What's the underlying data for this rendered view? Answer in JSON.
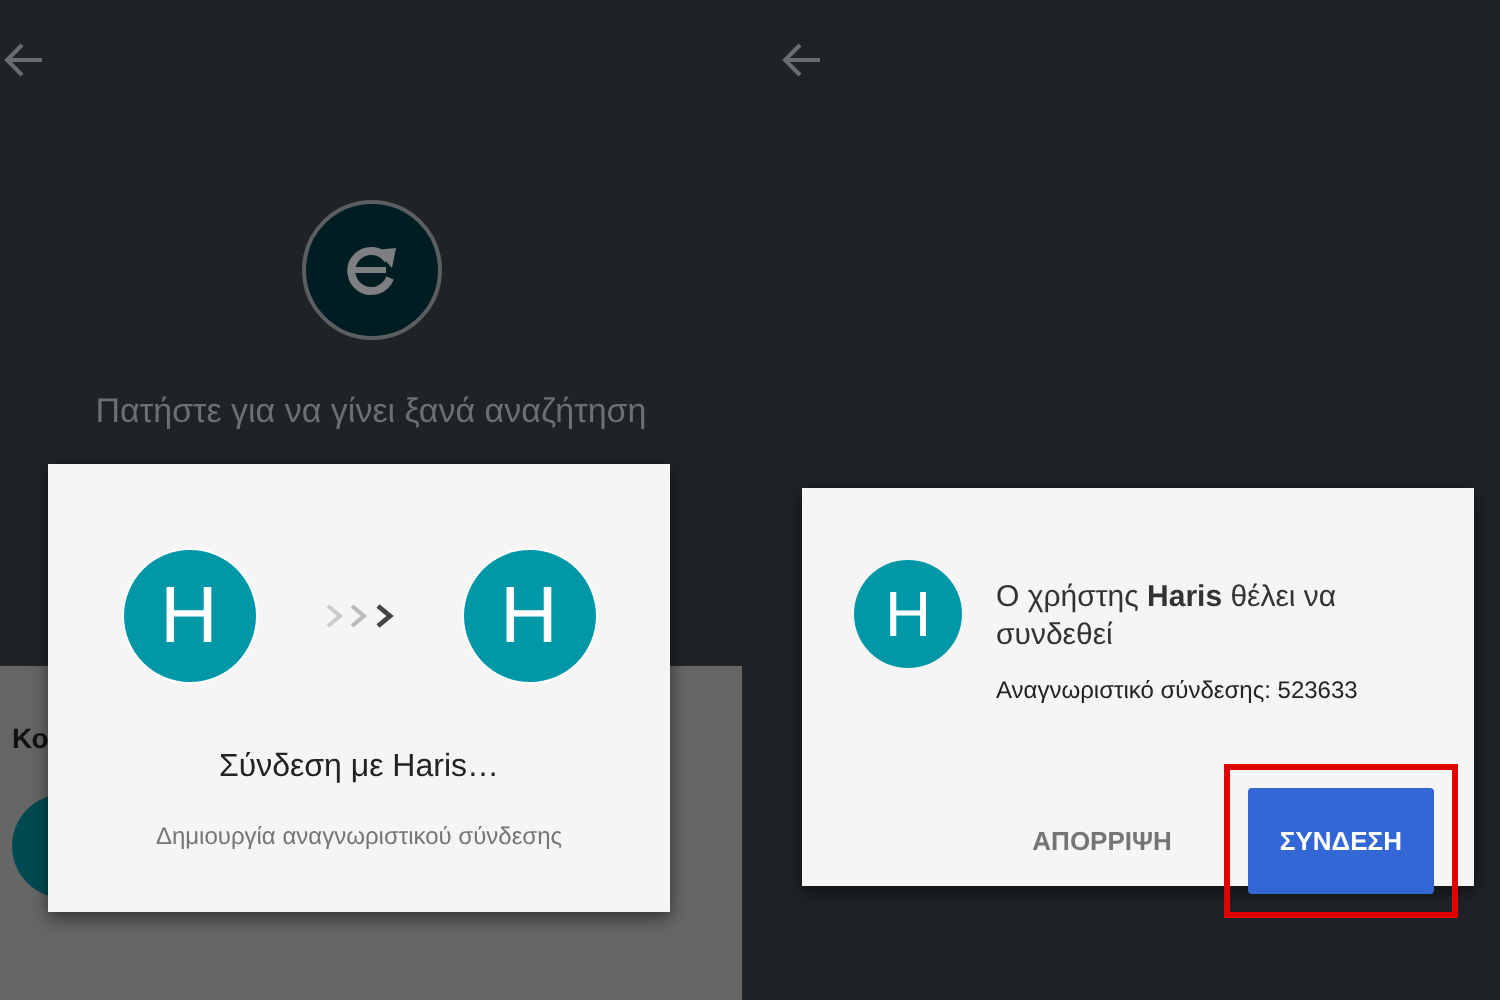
{
  "left_screen": {
    "search_hint": "Πατήστε για να γίνει ξανά αναζήτηση",
    "sheet": {
      "title": "Κο"
    },
    "dialog": {
      "avatars": [
        "H",
        "H"
      ],
      "title": "Σύνδεση με Haris…",
      "subtitle": "Δημιουργία αναγνωριστικού σύνδεσης"
    }
  },
  "right_screen": {
    "dialog": {
      "avatar": "H",
      "message": "Ο χρήστης **Haris** θέλει να συνδεθεί",
      "code": "Αναγνωριστικό σύνδεσης: 523633",
      "buttons": [
        {
          "label": "ΑΠΟΡΡΙΨΗ",
          "kind": "text",
          "highlighted": false
        },
        {
          "label": "ΣΥΝΔΕΣΗ",
          "kind": "primary",
          "highlighted": true
        }
      ]
    }
  }
}
